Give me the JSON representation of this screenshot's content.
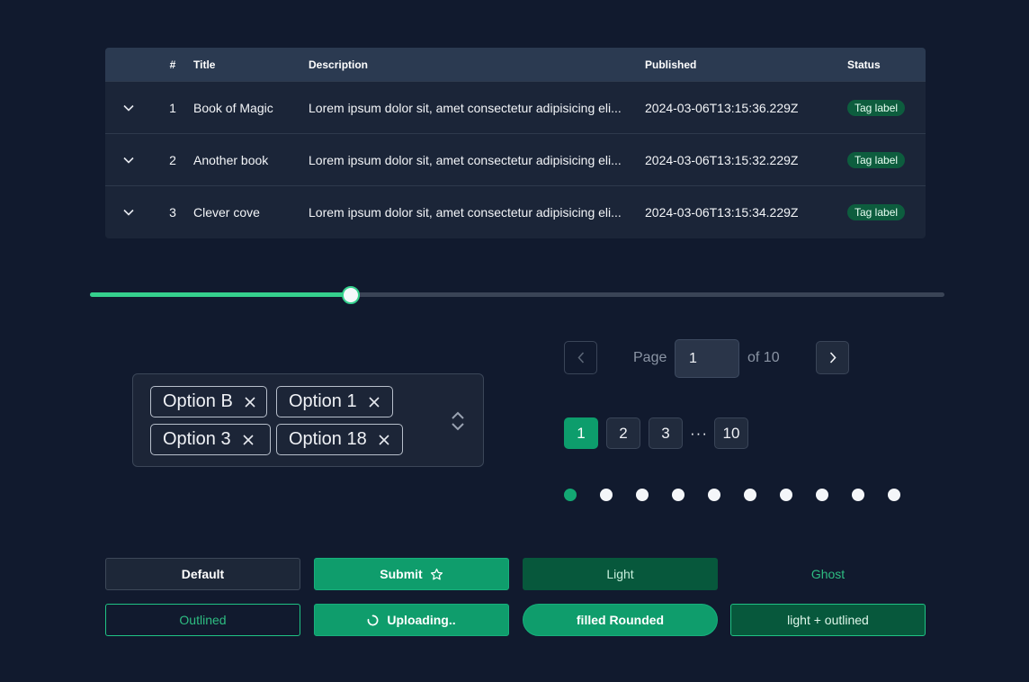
{
  "colors": {
    "background": "#111a2e",
    "accent": "#0f9d6c",
    "accent_bright": "#35d08d",
    "tag_bg": "#0d5d3e"
  },
  "table": {
    "headers": {
      "num": "#",
      "title": "Title",
      "description": "Description",
      "published": "Published",
      "status": "Status"
    },
    "rows": [
      {
        "num": "1",
        "title": "Book of Magic",
        "description": "Lorem ipsum dolor sit, amet consectetur adipisicing eli...",
        "published": "2024-03-06T13:15:36.229Z",
        "status": "Tag label"
      },
      {
        "num": "2",
        "title": "Another book",
        "description": "Lorem ipsum dolor sit, amet consectetur adipisicing eli...",
        "published": "2024-03-06T13:15:32.229Z",
        "status": "Tag label"
      },
      {
        "num": "3",
        "title": "Clever cove",
        "description": "Lorem ipsum dolor sit, amet consectetur adipisicing eli...",
        "published": "2024-03-06T13:15:34.229Z",
        "status": "Tag label"
      }
    ],
    "expand_icon": "chevron-down-icon"
  },
  "slider": {
    "value_fraction": 0.305
  },
  "multiselect": {
    "chips": [
      "Option B",
      "Option 1",
      "Option 3",
      "Option 18"
    ],
    "remove_icon": "close-icon",
    "toggle_icon": "chevron-up-down-icon"
  },
  "pagination": {
    "page_label": "Page",
    "current_page": "1",
    "of_label": "of 10",
    "pages": [
      "1",
      "2",
      "3",
      "10"
    ],
    "ellipsis": "···",
    "active_page": "1",
    "prev_icon": "chevron-left-icon",
    "next_icon": "chevron-right-icon",
    "dot_count": 10,
    "active_dot": 0
  },
  "buttons": {
    "default": "Default",
    "submit": "Submit",
    "light": "Light",
    "ghost": "Ghost",
    "outlined": "Outlined",
    "uploading": "Uploading..",
    "filled_rounded": "filled Rounded",
    "light_outlined": "light + outlined",
    "submit_icon": "star-icon",
    "uploading_icon": "spinner-icon"
  }
}
